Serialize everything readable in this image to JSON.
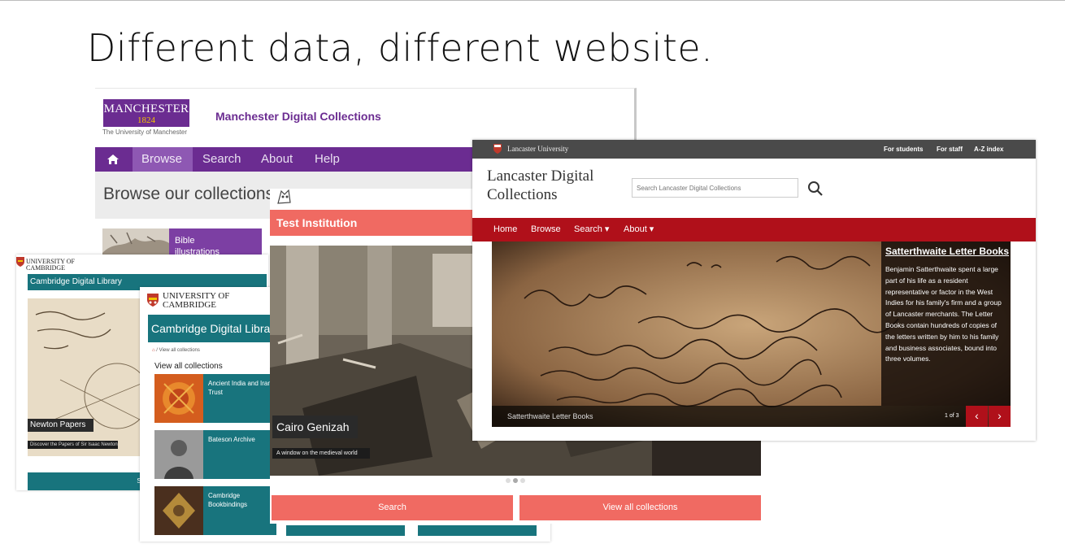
{
  "slide": {
    "title": "Different data, different website."
  },
  "manchester": {
    "logo_word": "MANCHESTER",
    "logo_year": "1824",
    "university": "The University of Manchester",
    "site_title": "Manchester Digital Collections",
    "nav": [
      "Browse",
      "Search",
      "About",
      "Help"
    ],
    "heading": "Browse our collections",
    "tile_label": "Bible illustrations"
  },
  "cambridge_back": {
    "university_line1": "UNIVERSITY OF",
    "university_line2": "CAMBRIDGE",
    "site_title": "Cambridge Digital Library",
    "feature_title": "Newton Papers",
    "feature_sub": "Discover the Papers of Sir Isaac Newton",
    "search_label": "Search"
  },
  "cambridge_front": {
    "university_line1": "UNIVERSITY OF",
    "university_line2": "CAMBRIDGE",
    "site_title": "Cambridge Digital Library",
    "breadcrumb": "/ View all collections",
    "heading": "View all collections",
    "collections": [
      "Ancient India and Iran Trust",
      "Bateson Archive",
      "Cambridge Bookbindings"
    ]
  },
  "test_institution": {
    "site_title": "Test Institution",
    "slide_title": "Cairo Genizah",
    "slide_sub": "A window on the medieval world",
    "buttons": [
      "Search",
      "View all collections"
    ]
  },
  "lancaster": {
    "university": "Lancaster University",
    "top_links": [
      "For students",
      "For staff",
      "A-Z index"
    ],
    "title_line1": "Lancaster Digital",
    "title_line2": "Collections",
    "search_placeholder": "Search Lancaster Digital Collections",
    "nav": [
      "Home",
      "Browse",
      "Search ▾",
      "About ▾"
    ],
    "feature_title": "Satterthwaite Letter Books",
    "feature_desc": "Benjamin Satterthwaite spent a large part of his life as a resident representative or factor in the West Indies for his family's firm and a group of Lancaster merchants. The Letter Books contain hundreds of copies of the letters written by him to his family and business associates, bound into three volumes.",
    "caption": "Satterthwaite Letter Books",
    "counter": "1 of 3"
  },
  "colors": {
    "manchester_purple": "#6b2c91",
    "cambridge_teal": "#18747d",
    "test_coral": "#f06a62",
    "lancaster_red": "#b0101a"
  }
}
